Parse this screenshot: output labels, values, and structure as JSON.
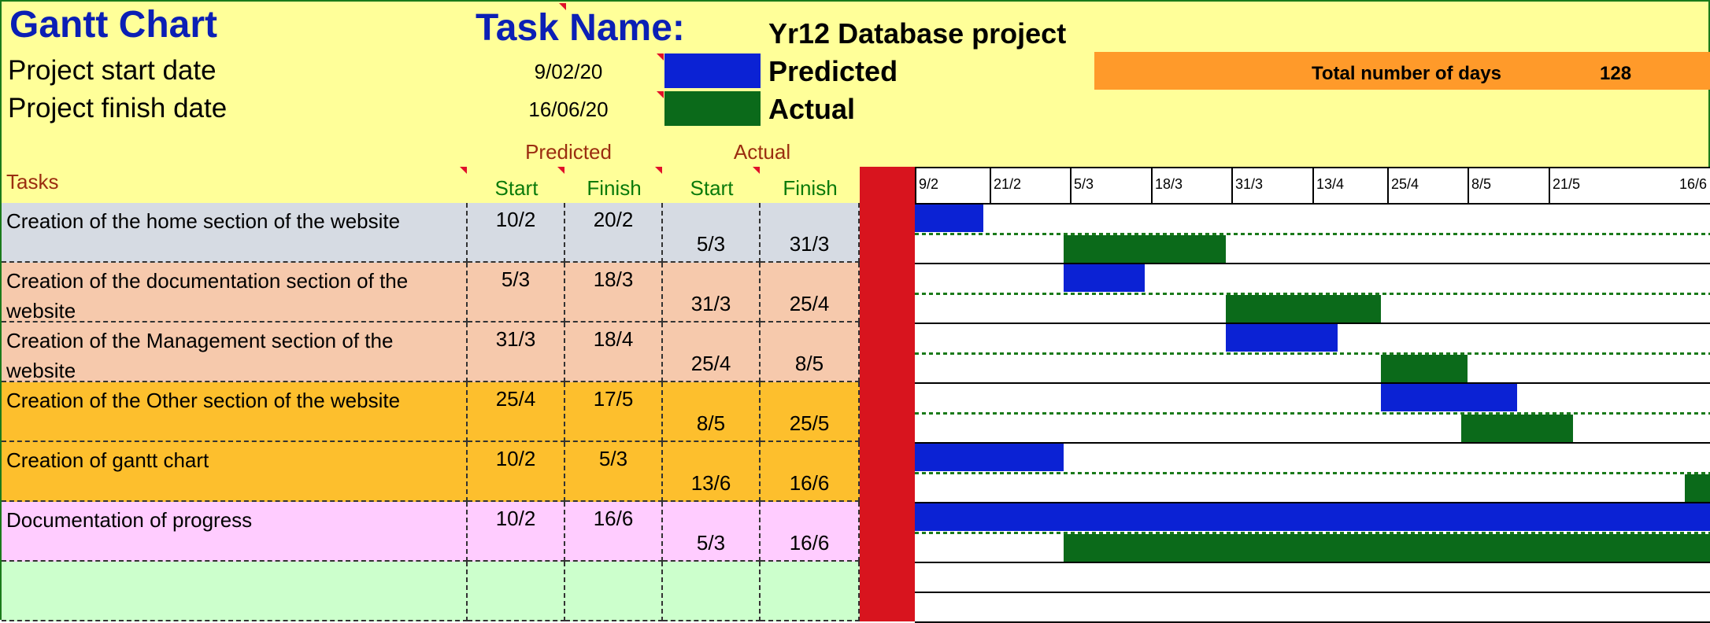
{
  "header": {
    "chart_title": "Gantt Chart",
    "task_name_label": "Task Name:",
    "task_name_value": "Yr12 Database project",
    "start_label": "Project start date",
    "start_value": "9/02/20",
    "finish_label": "Project finish date",
    "finish_value": "16/06/20",
    "legend_predicted": "Predicted",
    "legend_actual": "Actual",
    "total_days_label": "Total number of days",
    "total_days_value": "128"
  },
  "colors": {
    "predicted": "#0b22d4",
    "actual": "#0b6a1a",
    "background": "#ffff99",
    "total_bar": "#ff9a2a",
    "divider": "#d8141e"
  },
  "table": {
    "tasks_header": "Tasks",
    "predicted_group": "Predicted",
    "actual_group": "Actual",
    "col_start": "Start",
    "col_finish": "Finish",
    "rows": [
      {
        "task": "Creation of the home section of the website",
        "pred_start": "10/2",
        "pred_finish": "20/2",
        "act_start": "5/3",
        "act_finish": "31/3",
        "color": "#d6dbe3"
      },
      {
        "task": "Creation of the documentation section of the website",
        "pred_start": "5/3",
        "pred_finish": "18/3",
        "act_start": "31/3",
        "act_finish": "25/4",
        "color": "#f6c9ac"
      },
      {
        "task": "Creation of the Management section of the website",
        "pred_start": "31/3",
        "pred_finish": "18/4",
        "act_start": "25/4",
        "act_finish": "8/5",
        "color": "#f6c9ac"
      },
      {
        "task": "Creation of the Other section of the website",
        "pred_start": "25/4",
        "pred_finish": "17/5",
        "act_start": "8/5",
        "act_finish": "25/5",
        "color": "#fdbf2d"
      },
      {
        "task": "Creation of gantt chart",
        "pred_start": "10/2",
        "pred_finish": "5/3",
        "act_start": "13/6",
        "act_finish": "16/6",
        "color": "#fdbf2d"
      },
      {
        "task": "Documentation of progress",
        "pred_start": "10/2",
        "pred_finish": "16/6",
        "act_start": "5/3",
        "act_finish": "16/6",
        "color": "#ffccff"
      },
      {
        "task": "",
        "pred_start": "",
        "pred_finish": "",
        "act_start": "",
        "act_finish": "",
        "color": "#ccffcc"
      }
    ]
  },
  "chart_data": {
    "type": "bar",
    "timeline_labels": [
      "9/2",
      "21/2",
      "5/3",
      "18/3",
      "31/3",
      "13/4",
      "25/4",
      "8/5",
      "21/5",
      "16/6"
    ],
    "timeline_days": [
      0,
      12,
      25,
      38,
      51,
      64,
      76,
      89,
      102,
      128
    ],
    "total_days": 128,
    "series": [
      {
        "name": "Predicted",
        "color": "#0b22d4",
        "bars": [
          [
            0,
            11
          ],
          [
            24,
            37
          ],
          [
            50,
            68
          ],
          [
            75,
            97
          ],
          [
            0,
            24
          ],
          [
            0,
            128
          ]
        ]
      },
      {
        "name": "Actual",
        "color": "#0b6a1a",
        "bars": [
          [
            24,
            50
          ],
          [
            50,
            75
          ],
          [
            75,
            89
          ],
          [
            88,
            106
          ],
          [
            124,
            128
          ],
          [
            24,
            128
          ]
        ]
      }
    ]
  }
}
